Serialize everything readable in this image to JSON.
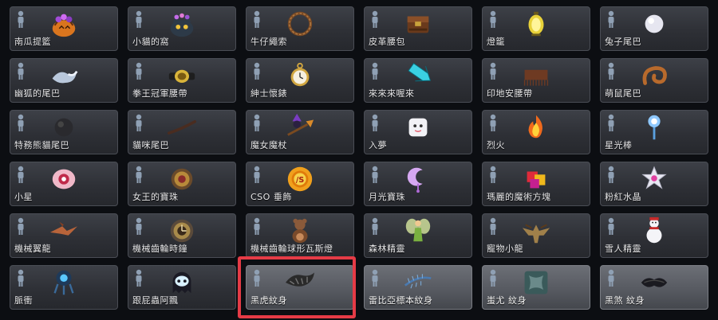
{
  "items": [
    {
      "label": "南瓜提籃",
      "icon": "pumpkin-basket-icon"
    },
    {
      "label": "小貓的窩",
      "icon": "cat-bed-icon"
    },
    {
      "label": "牛仔繩索",
      "icon": "lasso-icon"
    },
    {
      "label": "皮革腰包",
      "icon": "leather-pouch-icon"
    },
    {
      "label": "燈籠",
      "icon": "lantern-icon"
    },
    {
      "label": "兔子尾巴",
      "icon": "bunny-tail-icon"
    },
    {
      "label": "幽狐的尾巴",
      "icon": "fox-tail-icon"
    },
    {
      "label": "拳王冠軍腰帶",
      "icon": "champion-belt-icon"
    },
    {
      "label": "紳士懷錶",
      "icon": "pocket-watch-icon"
    },
    {
      "label": "來來來喔來",
      "icon": "cyan-arrow-icon"
    },
    {
      "label": "印地安腰帶",
      "icon": "indian-belt-icon"
    },
    {
      "label": "萌鼠尾巴",
      "icon": "mouse-tail-icon"
    },
    {
      "label": "特務熊貓尾巴",
      "icon": "panda-tail-icon"
    },
    {
      "label": "貓咪尾巴",
      "icon": "cat-tail-icon"
    },
    {
      "label": "魔女魔杖",
      "icon": "witch-broom-icon"
    },
    {
      "label": "入夢",
      "icon": "dream-pillow-icon"
    },
    {
      "label": "烈火",
      "icon": "fire-spirit-icon"
    },
    {
      "label": "星光棒",
      "icon": "star-wand-icon"
    },
    {
      "label": "小星",
      "icon": "little-star-icon"
    },
    {
      "label": "女王的寶珠",
      "icon": "queen-orb-icon"
    },
    {
      "label": "CSO 垂飾",
      "icon": "cso-sun-pendant-icon"
    },
    {
      "label": "月光寶珠",
      "icon": "moon-orb-icon"
    },
    {
      "label": "瑪麗的魔術方塊",
      "icon": "magic-cube-icon"
    },
    {
      "label": "粉紅水晶",
      "icon": "pink-crystal-icon"
    },
    {
      "label": "機械翼龍",
      "icon": "pterodactyl-icon"
    },
    {
      "label": "機械齒輪時鐘",
      "icon": "gear-clock-icon"
    },
    {
      "label": "機械齒輪球形瓦斯燈",
      "icon": "teddy-bear-lamp-icon"
    },
    {
      "label": "森林精靈",
      "icon": "forest-fairy-icon"
    },
    {
      "label": "寵物小龍",
      "icon": "pet-dragon-icon"
    },
    {
      "label": "雪人精靈",
      "icon": "snowman-icon"
    },
    {
      "label": "脈衝",
      "icon": "pulse-drone-icon"
    },
    {
      "label": "跟屁蟲阿飄",
      "icon": "ghost-icon"
    },
    {
      "label": "黑虎紋身",
      "icon": "black-tiger-tattoo-icon"
    },
    {
      "label": "雷比亞標本紋身",
      "icon": "specimen-tattoo-icon"
    },
    {
      "label": "蚩尤 紋身",
      "icon": "chiyou-tattoo-icon"
    },
    {
      "label": "黑煞 紋身",
      "icon": "black-evil-tattoo-icon"
    }
  ]
}
